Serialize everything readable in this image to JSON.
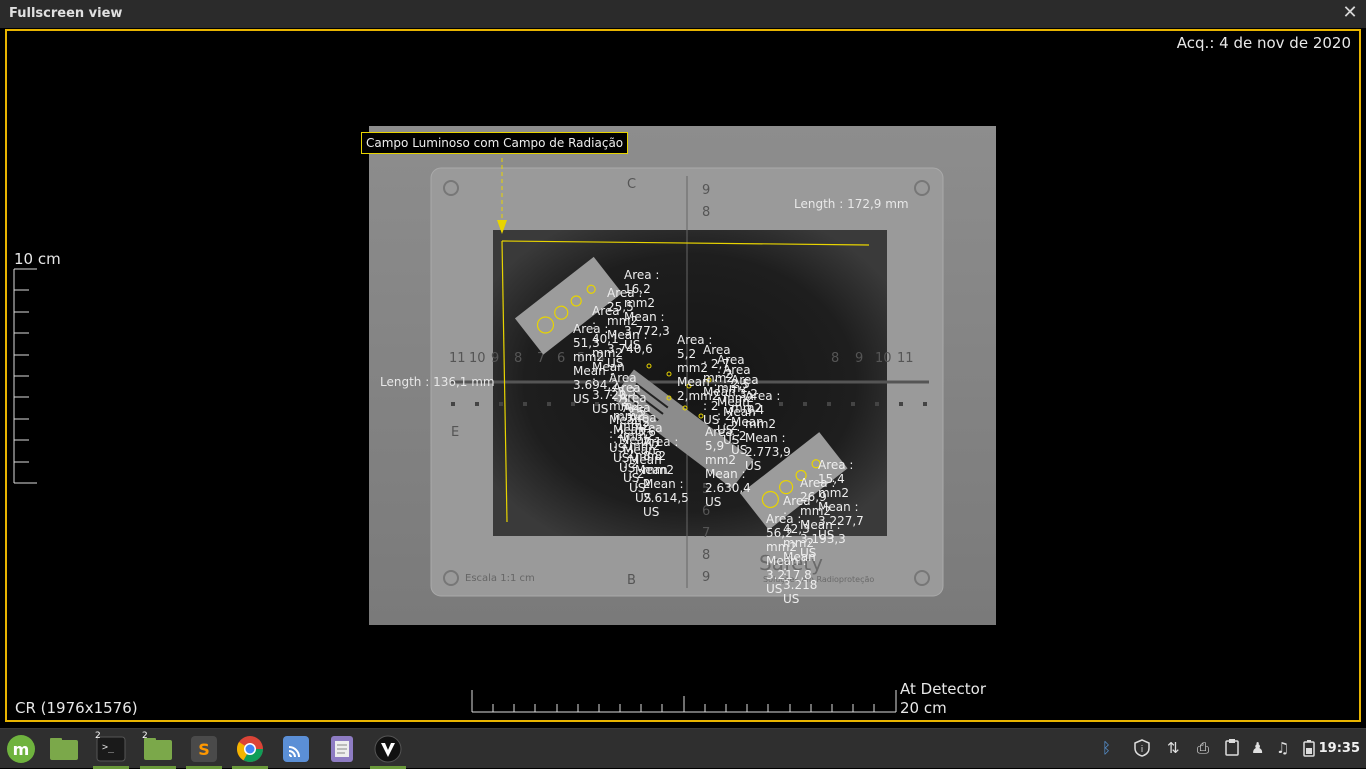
{
  "window": {
    "title": "Fullscreen view",
    "close_icon": "close-icon"
  },
  "viewer": {
    "acquisition": "Acq.: 4 de nov de 2020",
    "left_scale_label": "10 cm",
    "bottom_left_info": "CR (1976x1576)",
    "bottom_scale_line1": "At Detector",
    "bottom_scale_line2": "20 cm",
    "border_color": "#e8b400"
  },
  "annotations": {
    "callout": "Campo Luminoso com Campo de Radiação",
    "length_top": "Length : 172,9 mm",
    "length_left": "Length : 136,1 mm",
    "measurements_upper_left": [
      {
        "area": "Area : 16,2 mm2",
        "mean": "Mean : 3.772,3 US"
      },
      {
        "area": "Area : 25,5 mm2",
        "mean": "Mean : 3.740,6 US"
      },
      {
        "area": "Area : 40,1 mm2",
        "mean": "Mean : 3.720 US"
      },
      {
        "area": "Area : 51,3 mm2",
        "mean": "Mean : 3.694,2 US"
      }
    ],
    "measurements_center": [
      {
        "area": "Area : 5,2 mm2",
        "mean": "Mean : 2,mm2"
      },
      {
        "area": "Area : 2,7 mm2",
        "mean": "Mean : 2 US"
      },
      {
        "area": "Area : 2 mm2",
        "mean": "Mean : 2 US"
      },
      {
        "area": "Area : 2,5 mm2",
        "mean": "Mean : 2 US"
      },
      {
        "area": "Area : 3,2 mm2",
        "mean": "Mean : 2 US"
      },
      {
        "area": "Area : 3,4 mm2",
        "mean": "Mean : 2.773,9 US"
      },
      {
        "area": "Area : 3,3 mm2",
        "mean": "Mean : 2 US"
      },
      {
        "area": "Area : 2 mm2",
        "mean": "Mean : 2 US"
      },
      {
        "area": "Area : 2,5 mm2",
        "mean": "Mean : 2 US"
      },
      {
        "area": "Area : 4,2 mm2",
        "mean": "Mean : 2 US"
      },
      {
        "area": "Area : 3,6 mm2",
        "mean": "Mean : 2 US"
      },
      {
        "area": "Area : 7,1 mm2",
        "mean": "Mean : 2 US"
      },
      {
        "area": "Area : 5,9 mm2",
        "mean": "Mean : 2.630,4 US"
      },
      {
        "area": "Area : 8,8 mm2",
        "mean": "Mean : 2.614,5 US"
      }
    ],
    "measurements_lower_right": [
      {
        "area": "Area : 15,4 mm2",
        "mean": "Mean : 3.227,7 US"
      },
      {
        "area": "Area : 26,9 mm2",
        "mean": "Mean : 3.193,3 US"
      },
      {
        "area": "Area : 42,3 mm2",
        "mean": "Mean : 3.218 US"
      },
      {
        "area": "Area : 56,2 mm2",
        "mean": "Mean : 3.217,8 US"
      }
    ],
    "phantom_text_left": "Escala 1:1 cm",
    "phantom_text_brand": "Safety",
    "phantom_text_brand_sub": "Soluções em Radioproteção"
  },
  "taskbar": {
    "apps": [
      {
        "name": "mint-menu-icon",
        "badge": ""
      },
      {
        "name": "files-icon",
        "badge": ""
      },
      {
        "name": "terminal-icon",
        "badge": "2"
      },
      {
        "name": "folder-icon",
        "badge": "2"
      },
      {
        "name": "sublime-icon",
        "badge": ""
      },
      {
        "name": "chrome-icon",
        "badge": ""
      },
      {
        "name": "cast-icon",
        "badge": ""
      },
      {
        "name": "notes-icon",
        "badge": ""
      },
      {
        "name": "viewer-app-icon",
        "badge": ""
      }
    ],
    "tray": [
      "bluetooth-icon",
      "shield-icon",
      "network-icon",
      "printer-icon",
      "clipboard-icon",
      "notification-icon",
      "music-icon",
      "battery-icon"
    ],
    "clock": "19:35"
  }
}
